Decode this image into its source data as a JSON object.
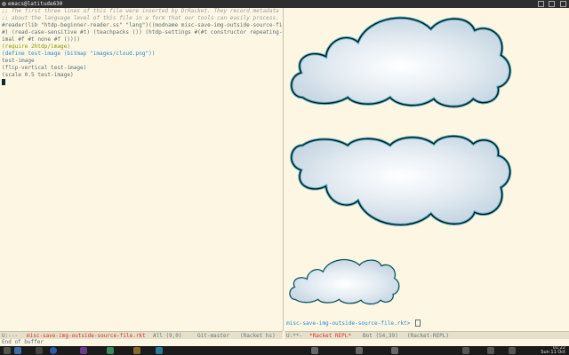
{
  "window": {
    "title": "emacs@latitude630"
  },
  "editor": {
    "lines": [
      ";; The first three lines of this file were inserted by DrRacket. They record metadata",
      ";; about the language level of this file in a form that our tools can easily process.",
      "#reader(lib \"htdp-beginner-reader.ss\" \"lang\")((modname misc-save-img-outside-source-file",
      "#) (read-case-sensitive #t) (teachpacks ()) (htdp-settings #(#t constructor repeating-dec",
      "imal #f #t none #f ())))",
      "(require 2htdp/image)",
      "(define test-image (bitmap \"images/cloud.png\"))",
      "test-image",
      "(flip-vertical test-image)",
      "(scale 0.5 test-image)"
    ]
  },
  "repl": {
    "prompt": "misc-save-img-outside-source-file.rkt> ",
    "images": [
      {
        "name": "cloud",
        "scale": 1,
        "flipped": false
      },
      {
        "name": "cloud",
        "scale": 1,
        "flipped": true
      },
      {
        "name": "cloud",
        "scale": 0.5,
        "flipped": false
      }
    ]
  },
  "modeline_left": {
    "status": "U:---",
    "buffer": "misc-save-img-outside-source-file.rkt",
    "position": "All (9,0)",
    "vc": "Git-master",
    "mode": "(Racket hs)"
  },
  "modeline_right": {
    "status": "U:**-",
    "buffer": "*Racket REPL*",
    "position": "Bot (54,39)",
    "mode": "(Racket-REPL)"
  },
  "minibuffer": {
    "text": "End of buffer"
  },
  "taskbar": {
    "time": "01:22",
    "date": "Sun 11 Oct"
  },
  "colors": {
    "background": "#fdf6e3",
    "taskbar": "#1b1b1b",
    "titlebar": "#2e2e2e",
    "keyword": "#268bd2",
    "comment": "#93a1a1"
  }
}
